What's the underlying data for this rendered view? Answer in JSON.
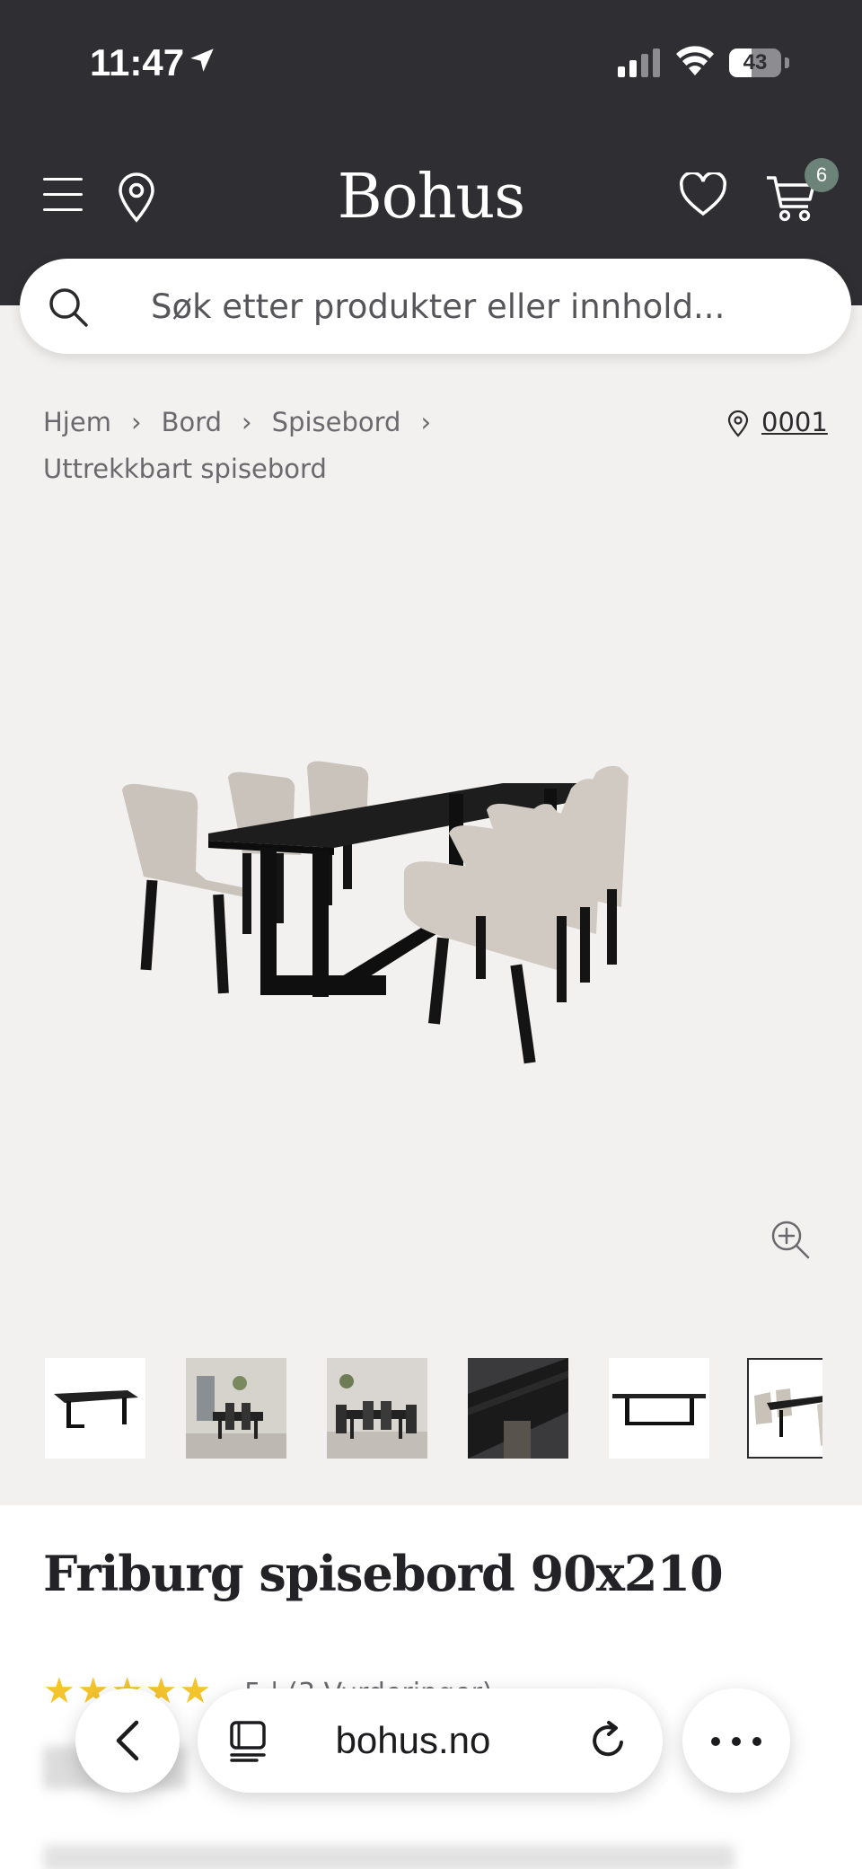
{
  "status_bar": {
    "time": "11:47",
    "battery": "43",
    "battery_level": 0.43
  },
  "nav": {
    "logo": "Bohus",
    "cart_count": "6"
  },
  "search": {
    "placeholder": "Søk etter produkter eller innhold..."
  },
  "breadcrumb": {
    "items": [
      "Hjem",
      "Bord",
      "Spisebord"
    ],
    "current": "Uttrekkbart spisebord",
    "separator": "›"
  },
  "store": {
    "code": "0001"
  },
  "product": {
    "title": "Friburg spisebord 90x210",
    "stars": "★★★★★",
    "rating_text": "5 | (3 Vurderinger)"
  },
  "icons": {
    "menu": "menu-icon",
    "location": "location-pin-icon",
    "favorite": "heart-icon",
    "cart": "cart-icon",
    "search": "search-icon",
    "zoom": "zoom-in-icon",
    "back": "chevron-left-icon",
    "tabs": "tabs-icon",
    "reload": "reload-icon",
    "more": "more-icon"
  },
  "browser": {
    "url": "bohus.no"
  },
  "colors": {
    "header_bg": "#2f2f33",
    "page_bg": "#f3f1ef",
    "badge": "#6b8379",
    "star": "#f4c42f"
  }
}
